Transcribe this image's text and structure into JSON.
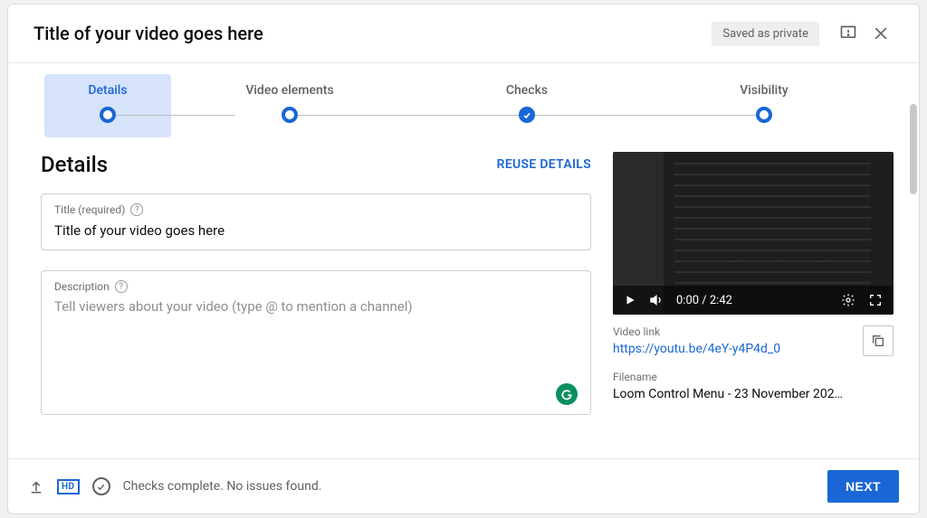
{
  "header": {
    "title": "Title of your video goes here",
    "save_badge": "Saved as private"
  },
  "stepper": {
    "steps": [
      {
        "label": "Details",
        "state": "active"
      },
      {
        "label": "Video elements",
        "state": "pending"
      },
      {
        "label": "Checks",
        "state": "done"
      },
      {
        "label": "Visibility",
        "state": "pending"
      }
    ]
  },
  "details": {
    "section_title": "Details",
    "reuse_label": "REUSE DETAILS",
    "title_field": {
      "label": "Title (required)",
      "value": "Title of your video goes here"
    },
    "description_field": {
      "label": "Description",
      "placeholder": "Tell viewers about your video (type @ to mention a channel)",
      "value": ""
    }
  },
  "preview": {
    "playback_time": "0:00 / 2:42",
    "video_link_label": "Video link",
    "video_link": "https://youtu.be/4eY-y4P4d_0",
    "filename_label": "Filename",
    "filename": "Loom Control Menu - 23 November 202…"
  },
  "footer": {
    "checks_text": "Checks complete. No issues found.",
    "next_label": "NEXT"
  }
}
